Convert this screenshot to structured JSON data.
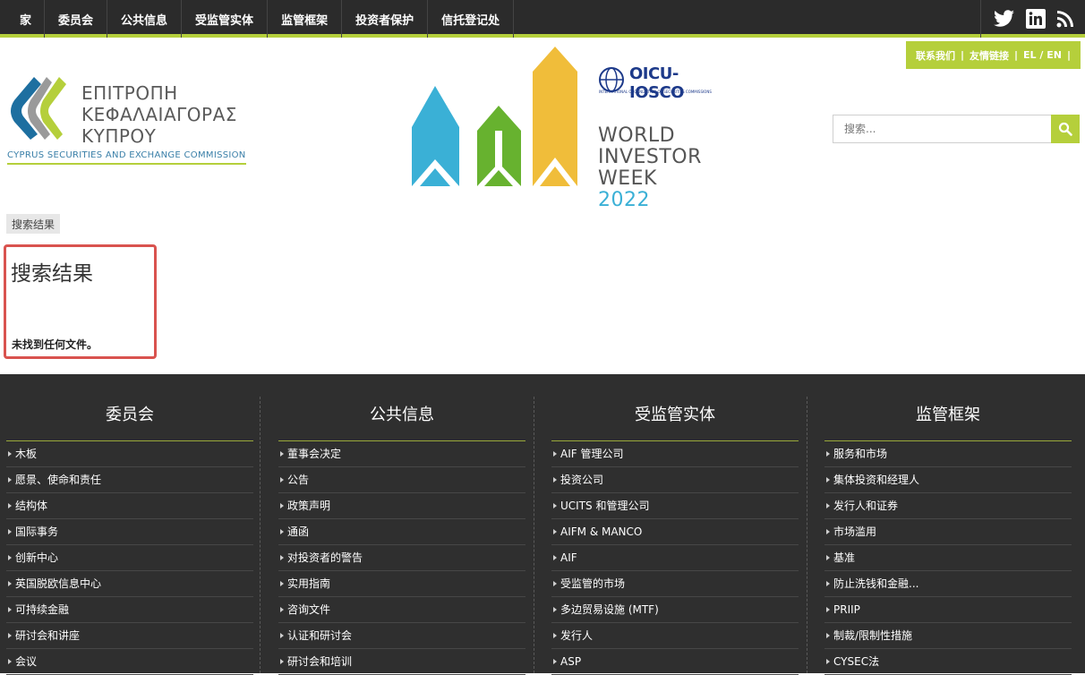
{
  "nav": {
    "items": [
      "家",
      "委员会",
      "公共信息",
      "受监管实体",
      "监管框架",
      "投资者保护",
      "信托登记处"
    ],
    "social_icons": [
      "twitter-icon",
      "linkedin-icon",
      "rss-icon"
    ]
  },
  "utility": {
    "contact": "联系我们",
    "links": "友情链接",
    "lang": "EL / EN",
    "sep1": "|",
    "sep2": "|",
    "sep3": "|"
  },
  "logo": {
    "greek_line1": "ΕΠΙΤΡΟΠΗ",
    "greek_line2": "ΚΕΦΑΛΑΙΑΓΟΡΑΣ",
    "greek_line3": "ΚΥΠΡΟΥ",
    "english": "CYPRUS SECURITIES AND EXCHANGE COMMISSION"
  },
  "banner": {
    "iosco": "OICU-IOSCO",
    "iosco_sub": "INTERNATIONAL ORGANIZATION OF SECURITIES COMMISSIONS",
    "line1": "WORLD",
    "line2": "INVESTOR",
    "line3": "WEEK",
    "year": "2022"
  },
  "search": {
    "placeholder": "搜索..."
  },
  "breadcrumb": "搜索结果",
  "result": {
    "title": "搜索结果",
    "message": "未找到任何文件。"
  },
  "footer": {
    "columns": [
      {
        "title": "委员会",
        "items": [
          "木板",
          "愿景、使命和责任",
          "结构体",
          "国际事务",
          "创新中心",
          "英国脱欧信息中心",
          "可持续金融",
          "研讨会和讲座",
          "会议"
        ]
      },
      {
        "title": "公共信息",
        "items": [
          "董事会决定",
          "公告",
          "政策声明",
          "通函",
          "对投资者的警告",
          "实用指南",
          "咨询文件",
          "认证和研讨会",
          "研讨会和培训"
        ]
      },
      {
        "title": "受监管实体",
        "items": [
          "AIF 管理公司",
          "投资公司",
          "UCITS 和管理公司",
          "AIFM & MANCO",
          "AIF",
          "受监管的市场",
          "多边贸易设施 (MTF)",
          "发行人",
          "ASP"
        ]
      },
      {
        "title": "监管框架",
        "items": [
          "服务和市场",
          "集体投资和经理人",
          "发行人和证券",
          "市场滥用",
          "基准",
          "防止洗钱和金融...",
          "PRIIP",
          "制裁/限制性措施",
          "CYSEC法"
        ]
      }
    ]
  },
  "colors": {
    "accent": "#b5cf3b",
    "nav_bg": "#2b2b2b",
    "footer_bg": "#2f2f2f",
    "highlight_border": "#d9534f"
  }
}
